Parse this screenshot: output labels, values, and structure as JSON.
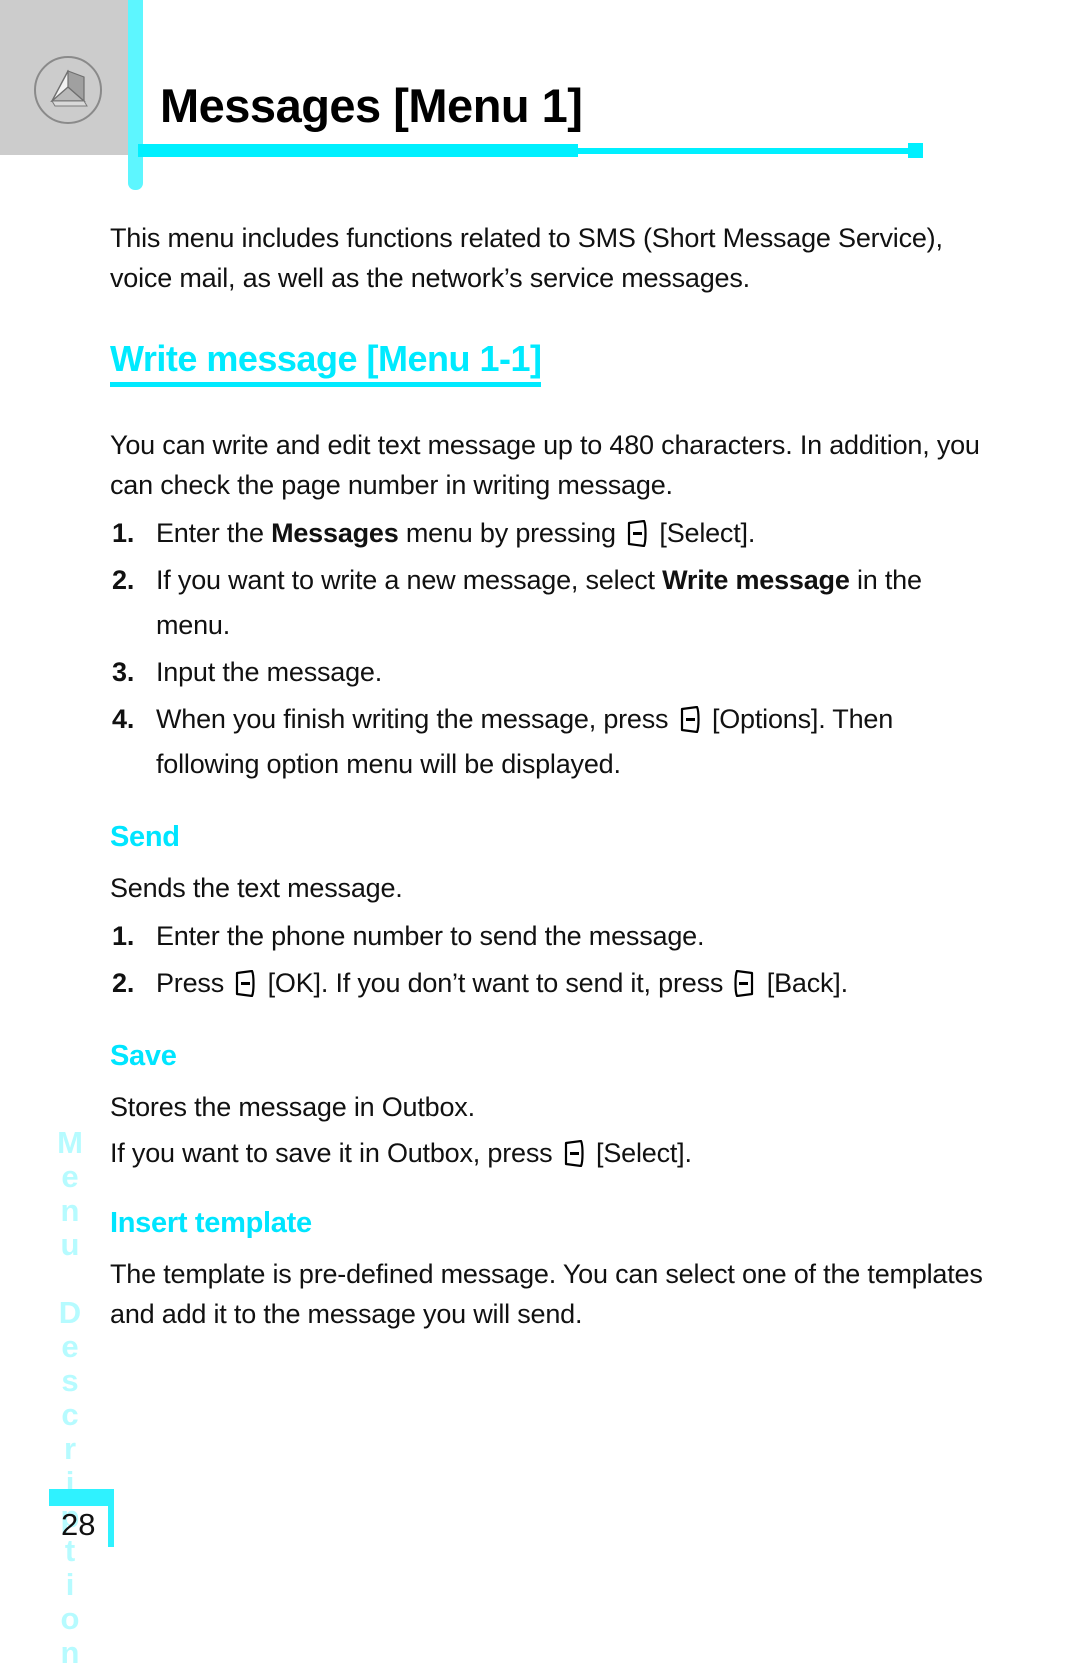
{
  "header": {
    "icon": "envelope-icon",
    "title": "Messages [Menu 1]",
    "accent_color": "#00f0ff",
    "gray_color": "#cccccc"
  },
  "content": {
    "intro": "This menu includes functions related to SMS (Short Message Service), voice mail, as well as the network’s service messages.",
    "section_heading": "Write message [Menu 1-1]",
    "section_intro": "You can write and edit text message up to 480 characters. In addition, you can check the page number in writing message.",
    "steps": [
      {
        "num": "1.",
        "pre": "Enter the ",
        "bold": "Messages",
        "mid": " menu by pressing ",
        "key": "left-softkey-icon",
        "post": " [Select]."
      },
      {
        "num": "2.",
        "pre": "If you want to write a new message, select ",
        "bold": "Write message",
        "mid": " in the menu.",
        "key": "",
        "post": ""
      },
      {
        "num": "3.",
        "pre": "Input the message.",
        "bold": "",
        "mid": "",
        "key": "",
        "post": ""
      },
      {
        "num": "4.",
        "pre": "When you finish writing the message, press ",
        "bold": "",
        "mid": "",
        "key": "left-softkey-icon",
        "post": " [Options]. Then following option menu will be displayed."
      }
    ],
    "subsections": [
      {
        "heading": "Send",
        "body": "Sends the text message.",
        "steps": [
          {
            "num": "1.",
            "pre": "Enter the phone number to send the message.",
            "key1": "",
            "mid": "",
            "key2": "",
            "post": ""
          },
          {
            "num": "2.",
            "pre": "Press ",
            "key1": "left-softkey-icon",
            "mid": " [OK]. If you don’t want to send it, press ",
            "key2": "right-softkey-icon",
            "post": " [Back]."
          }
        ]
      },
      {
        "heading": "Save",
        "body": "Stores the message in Outbox.",
        "line_pre": "If you want to save it in Outbox, press ",
        "line_key": "left-softkey-icon",
        "line_post": " [Select]."
      },
      {
        "heading": "Insert template",
        "body": "The template is pre-defined message. You can select one of the templates and add it to the message you will send."
      }
    ]
  },
  "sidetab": {
    "label": "Menu Description",
    "letters": [
      "M",
      "e",
      "n",
      "u",
      " ",
      "D",
      "e",
      "s",
      "c",
      "r",
      "i",
      "p",
      "t",
      "i",
      "o",
      "n"
    ],
    "color": "#b6fbff"
  },
  "footer": {
    "page_number": "28",
    "accent_color": "#2ff2ff"
  }
}
